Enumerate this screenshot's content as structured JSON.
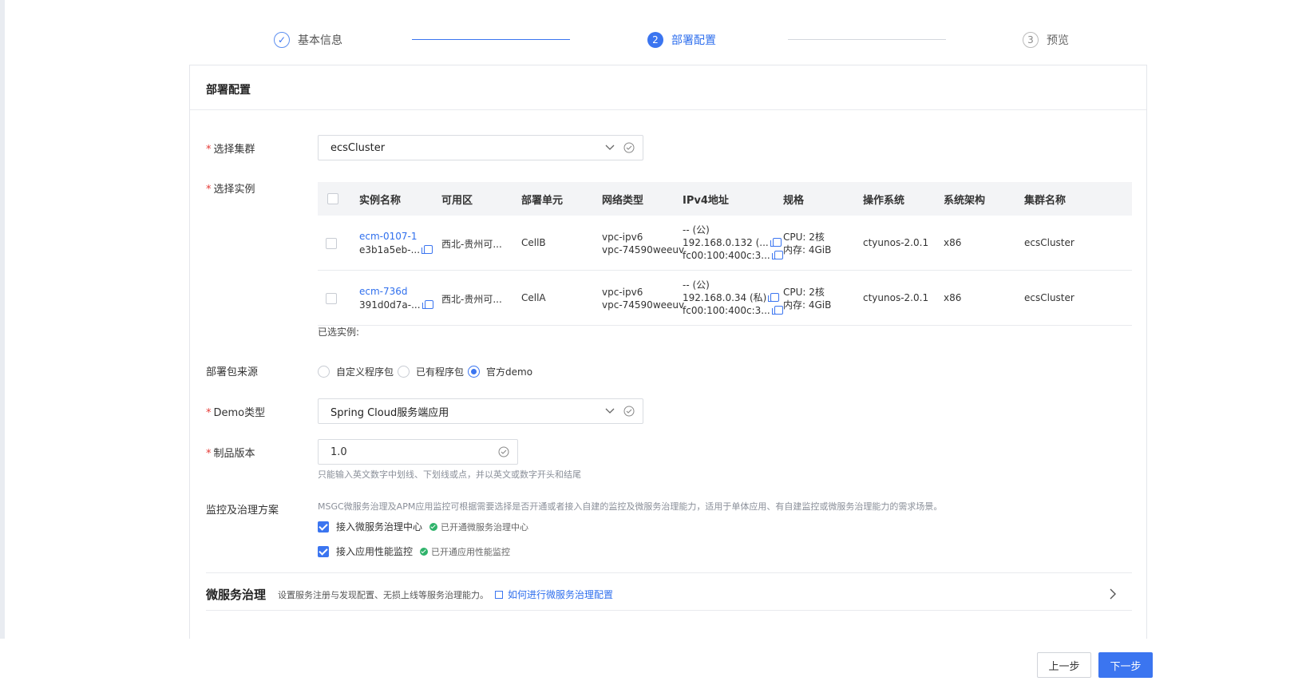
{
  "steps": [
    {
      "num": "✓",
      "label": "基本信息"
    },
    {
      "num": "2",
      "label": "部署配置"
    },
    {
      "num": "3",
      "label": "预览"
    }
  ],
  "card": {
    "title": "部署配置"
  },
  "form": {
    "cluster": {
      "label": "选择集群",
      "value": "ecsCluster"
    },
    "instance": {
      "label": "选择实例"
    },
    "table": {
      "headers": [
        "实例名称",
        "可用区",
        "部署单元",
        "网络类型",
        "IPv4地址",
        "规格",
        "操作系统",
        "系统架构",
        "集群名称"
      ],
      "rows": [
        {
          "name": "ecm-0107-1",
          "id": "e3b1a5eb-...",
          "zone": "西北-贵州可...",
          "unit": "CellB",
          "net1": "vpc-ipv6",
          "net2": "vpc-74590weeuv",
          "ip1": "-- (公)",
          "ip2": "192.168.0.132 (...",
          "ip3": "fc00:100:400c:3...",
          "spec1": "CPU: 2核",
          "spec2": "内存: 4GiB",
          "os": "ctyunos-2.0.1",
          "arch": "x86",
          "cluster": "ecsCluster"
        },
        {
          "name": "ecm-736d",
          "id": "391d0d7a-...",
          "zone": "西北-贵州可...",
          "unit": "CellA",
          "net1": "vpc-ipv6",
          "net2": "vpc-74590weeuv",
          "ip1": "-- (公)",
          "ip2": "192.168.0.34 (私)",
          "ip3": "fc00:100:400c:3...",
          "spec1": "CPU: 2核",
          "spec2": "内存: 4GiB",
          "os": "ctyunos-2.0.1",
          "arch": "x86",
          "cluster": "ecsCluster"
        }
      ]
    },
    "selected_label": "已选实例:",
    "source": {
      "label": "部署包来源",
      "options": [
        "自定义程序包",
        "已有程序包",
        "官方demo"
      ],
      "selected": "官方demo"
    },
    "demo_type": {
      "label": "Demo类型",
      "value": "Spring Cloud服务端应用"
    },
    "version": {
      "label": "制品版本",
      "value": "1.0",
      "hint": "只能输入英文数字中划线、下划线或点，并以英文或数字开头和结尾"
    },
    "monitor": {
      "label": "监控及治理方案",
      "desc": "MSGC微服务治理及APM应用监控可根据需要选择是否开通或者接入自建的监控及微服务治理能力，适用于单体应用、有自建监控或微服务治理能力的需求场景。",
      "opt1": "接入微服务治理中心",
      "status1": "已开通微服务治理中心",
      "opt2": "接入应用性能监控",
      "status2": "已开通应用性能监控"
    },
    "micro": {
      "title": "微服务治理",
      "desc": "设置服务注册与发现配置、无损上线等服务治理能力。",
      "link": "如何进行微服务治理配置"
    }
  },
  "footer": {
    "prev": "上一步",
    "next": "下一步"
  },
  "colors": {
    "accent": "#3b75f0",
    "success": "#2fb36b",
    "required": "#e53935"
  }
}
